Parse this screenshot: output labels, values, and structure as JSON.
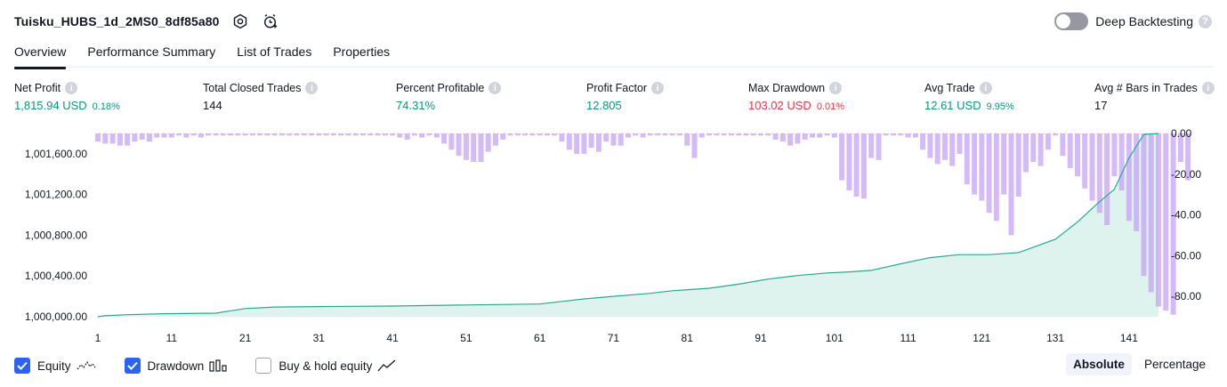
{
  "header": {
    "title": "Tuisku_HUBS_1d_2MS0_8df85a80",
    "settings_icon": "gear-icon",
    "add_alert_icon": "alarm-clock-plus-icon",
    "deep_backtesting_label": "Deep Backtesting",
    "help_symbol": "?"
  },
  "tabs": [
    {
      "label": "Overview"
    },
    {
      "label": "Performance Summary"
    },
    {
      "label": "List of Trades"
    },
    {
      "label": "Properties"
    }
  ],
  "metrics": {
    "info_symbol": "i",
    "net_profit": {
      "label": "Net Profit",
      "value": "1,815.94 USD",
      "sub": "0.18%"
    },
    "total_closed_trades": {
      "label": "Total Closed Trades",
      "value": "144"
    },
    "percent_profitable": {
      "label": "Percent Profitable",
      "value": "74.31%"
    },
    "profit_factor": {
      "label": "Profit Factor",
      "value": "12.805"
    },
    "max_drawdown": {
      "label": "Max Drawdown",
      "value": "103.02 USD",
      "sub": "0.01%"
    },
    "avg_trade": {
      "label": "Avg Trade",
      "value": "12.61 USD",
      "sub": "9.95%"
    },
    "avg_bars": {
      "label": "Avg # Bars in Trades",
      "value": "17"
    }
  },
  "colors": {
    "positive": "#089981",
    "negative": "#f23645",
    "equity_line": "#22ab94",
    "equity_fill": "#dff3ee",
    "drawdown_bar": "#c6a3f5",
    "accent": "#2962ff"
  },
  "chart_data": {
    "type": "area",
    "x_ticks": [
      "1",
      "11",
      "21",
      "31",
      "41",
      "51",
      "61",
      "71",
      "81",
      "91",
      "101",
      "111",
      "121",
      "131",
      "141"
    ],
    "left_axis_ticks": [
      "1,000,000.00",
      "1,000,400.00",
      "1,000,800.00",
      "1,001,200.00",
      "1,001,600.00"
    ],
    "right_axis_ticks": [
      "0.00",
      "-20.00",
      "-40.00",
      "-60.00",
      "-80.00"
    ],
    "equity_ylim": [
      1000000,
      1001800
    ],
    "drawdown_ylim": [
      -90,
      0
    ],
    "xlim": [
      1,
      145
    ],
    "series": [
      {
        "name": "Equity",
        "points": [
          [
            1,
            1000000
          ],
          [
            2,
            1000010
          ],
          [
            5,
            1000020
          ],
          [
            10,
            1000030
          ],
          [
            17,
            1000035
          ],
          [
            21,
            1000080
          ],
          [
            25,
            1000095
          ],
          [
            31,
            1000100
          ],
          [
            41,
            1000105
          ],
          [
            51,
            1000115
          ],
          [
            61,
            1000125
          ],
          [
            67,
            1000175
          ],
          [
            71,
            1000200
          ],
          [
            76,
            1000230
          ],
          [
            79,
            1000255
          ],
          [
            84,
            1000280
          ],
          [
            88,
            1000320
          ],
          [
            92,
            1000370
          ],
          [
            96,
            1000405
          ],
          [
            100,
            1000430
          ],
          [
            103,
            1000440
          ],
          [
            106,
            1000455
          ],
          [
            110,
            1000520
          ],
          [
            114,
            1000580
          ],
          [
            118,
            1000610
          ],
          [
            122,
            1000610
          ],
          [
            126,
            1000630
          ],
          [
            131,
            1000760
          ],
          [
            134,
            1000930
          ],
          [
            137,
            1001130
          ],
          [
            139,
            1001250
          ],
          [
            141,
            1001560
          ],
          [
            143,
            1001790
          ],
          [
            145,
            1001800
          ]
        ]
      },
      {
        "name": "Drawdown",
        "values": [
          -4,
          -5,
          -5,
          -6,
          -6,
          -4,
          -3,
          -4,
          -2,
          -2,
          -2,
          -1,
          -2,
          -1,
          -2,
          -1,
          -1,
          -1,
          -1,
          -1,
          -1,
          -1,
          -1,
          -1,
          -1,
          -1,
          -1,
          -1,
          -1,
          -1,
          -1,
          -1,
          -1,
          -1,
          -1,
          -1,
          -1,
          -1,
          -1,
          -1,
          -1,
          -2,
          -3,
          -1,
          -2,
          -1,
          -2,
          -5,
          -8,
          -11,
          -13,
          -14,
          -14,
          -9,
          -6,
          -3,
          -1,
          -1,
          -1,
          -1,
          -1,
          -1,
          -1,
          -4,
          -8,
          -10,
          -10,
          -7,
          -9,
          -4,
          -6,
          -6,
          -2,
          -1,
          -2,
          -1,
          -1,
          -1,
          -1,
          -1,
          -6,
          -12,
          -2,
          -1,
          -1,
          -1,
          -1,
          -1,
          -1,
          -1,
          -1,
          -1,
          -3,
          -4,
          -6,
          -5,
          -3,
          -2,
          -2,
          -1,
          -2,
          -23,
          -28,
          -31,
          -32,
          -12,
          -13,
          -1,
          -1,
          -1,
          -2,
          -2,
          -8,
          -12,
          -15,
          -13,
          -16,
          -10,
          -25,
          -30,
          -33,
          -39,
          -43,
          -30,
          -50,
          -31,
          -19,
          -14,
          -16,
          -8,
          -1,
          -11,
          -17,
          -21,
          -27,
          -33,
          -39,
          -45,
          -21,
          -28,
          -43,
          -48,
          -70,
          -78,
          -85,
          -87,
          -89,
          -14,
          -23
        ]
      }
    ]
  },
  "legend": {
    "equity_label": "Equity",
    "drawdown_label": "Drawdown",
    "buy_hold_label": "Buy & hold equity",
    "equity_checked": true,
    "drawdown_checked": true,
    "buy_hold_checked": false
  },
  "scale": {
    "absolute_label": "Absolute",
    "percentage_label": "Percentage",
    "selected": "Absolute"
  }
}
